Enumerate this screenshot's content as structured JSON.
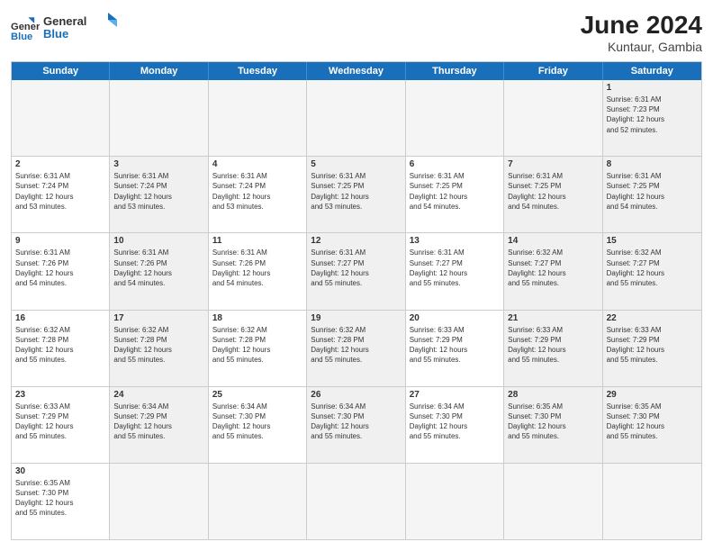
{
  "header": {
    "logo_general": "General",
    "logo_blue": "Blue",
    "month_year": "June 2024",
    "location": "Kuntaur, Gambia"
  },
  "days_of_week": [
    "Sunday",
    "Monday",
    "Tuesday",
    "Wednesday",
    "Thursday",
    "Friday",
    "Saturday"
  ],
  "weeks": [
    [
      {
        "day": "",
        "empty": true
      },
      {
        "day": "",
        "empty": true
      },
      {
        "day": "",
        "empty": true
      },
      {
        "day": "",
        "empty": true
      },
      {
        "day": "",
        "empty": true
      },
      {
        "day": "",
        "empty": true
      },
      {
        "day": "1",
        "info": "Sunrise: 6:31 AM\nSunset: 7:23 PM\nDaylight: 12 hours\nand 52 minutes.",
        "shaded": true
      }
    ],
    [
      {
        "day": "2",
        "info": "Sunrise: 6:31 AM\nSunset: 7:24 PM\nDaylight: 12 hours\nand 53 minutes.",
        "shaded": false
      },
      {
        "day": "3",
        "info": "Sunrise: 6:31 AM\nSunset: 7:24 PM\nDaylight: 12 hours\nand 53 minutes.",
        "shaded": true
      },
      {
        "day": "4",
        "info": "Sunrise: 6:31 AM\nSunset: 7:24 PM\nDaylight: 12 hours\nand 53 minutes.",
        "shaded": false
      },
      {
        "day": "5",
        "info": "Sunrise: 6:31 AM\nSunset: 7:25 PM\nDaylight: 12 hours\nand 53 minutes.",
        "shaded": true
      },
      {
        "day": "6",
        "info": "Sunrise: 6:31 AM\nSunset: 7:25 PM\nDaylight: 12 hours\nand 54 minutes.",
        "shaded": false
      },
      {
        "day": "7",
        "info": "Sunrise: 6:31 AM\nSunset: 7:25 PM\nDaylight: 12 hours\nand 54 minutes.",
        "shaded": true
      },
      {
        "day": "8",
        "info": "Sunrise: 6:31 AM\nSunset: 7:25 PM\nDaylight: 12 hours\nand 54 minutes.",
        "shaded": true
      }
    ],
    [
      {
        "day": "9",
        "info": "Sunrise: 6:31 AM\nSunset: 7:26 PM\nDaylight: 12 hours\nand 54 minutes.",
        "shaded": false
      },
      {
        "day": "10",
        "info": "Sunrise: 6:31 AM\nSunset: 7:26 PM\nDaylight: 12 hours\nand 54 minutes.",
        "shaded": true
      },
      {
        "day": "11",
        "info": "Sunrise: 6:31 AM\nSunset: 7:26 PM\nDaylight: 12 hours\nand 54 minutes.",
        "shaded": false
      },
      {
        "day": "12",
        "info": "Sunrise: 6:31 AM\nSunset: 7:27 PM\nDaylight: 12 hours\nand 55 minutes.",
        "shaded": true
      },
      {
        "day": "13",
        "info": "Sunrise: 6:31 AM\nSunset: 7:27 PM\nDaylight: 12 hours\nand 55 minutes.",
        "shaded": false
      },
      {
        "day": "14",
        "info": "Sunrise: 6:32 AM\nSunset: 7:27 PM\nDaylight: 12 hours\nand 55 minutes.",
        "shaded": true
      },
      {
        "day": "15",
        "info": "Sunrise: 6:32 AM\nSunset: 7:27 PM\nDaylight: 12 hours\nand 55 minutes.",
        "shaded": true
      }
    ],
    [
      {
        "day": "16",
        "info": "Sunrise: 6:32 AM\nSunset: 7:28 PM\nDaylight: 12 hours\nand 55 minutes.",
        "shaded": false
      },
      {
        "day": "17",
        "info": "Sunrise: 6:32 AM\nSunset: 7:28 PM\nDaylight: 12 hours\nand 55 minutes.",
        "shaded": true
      },
      {
        "day": "18",
        "info": "Sunrise: 6:32 AM\nSunset: 7:28 PM\nDaylight: 12 hours\nand 55 minutes.",
        "shaded": false
      },
      {
        "day": "19",
        "info": "Sunrise: 6:32 AM\nSunset: 7:28 PM\nDaylight: 12 hours\nand 55 minutes.",
        "shaded": true
      },
      {
        "day": "20",
        "info": "Sunrise: 6:33 AM\nSunset: 7:29 PM\nDaylight: 12 hours\nand 55 minutes.",
        "shaded": false
      },
      {
        "day": "21",
        "info": "Sunrise: 6:33 AM\nSunset: 7:29 PM\nDaylight: 12 hours\nand 55 minutes.",
        "shaded": true
      },
      {
        "day": "22",
        "info": "Sunrise: 6:33 AM\nSunset: 7:29 PM\nDaylight: 12 hours\nand 55 minutes.",
        "shaded": true
      }
    ],
    [
      {
        "day": "23",
        "info": "Sunrise: 6:33 AM\nSunset: 7:29 PM\nDaylight: 12 hours\nand 55 minutes.",
        "shaded": false
      },
      {
        "day": "24",
        "info": "Sunrise: 6:34 AM\nSunset: 7:29 PM\nDaylight: 12 hours\nand 55 minutes.",
        "shaded": true
      },
      {
        "day": "25",
        "info": "Sunrise: 6:34 AM\nSunset: 7:30 PM\nDaylight: 12 hours\nand 55 minutes.",
        "shaded": false
      },
      {
        "day": "26",
        "info": "Sunrise: 6:34 AM\nSunset: 7:30 PM\nDaylight: 12 hours\nand 55 minutes.",
        "shaded": true
      },
      {
        "day": "27",
        "info": "Sunrise: 6:34 AM\nSunset: 7:30 PM\nDaylight: 12 hours\nand 55 minutes.",
        "shaded": false
      },
      {
        "day": "28",
        "info": "Sunrise: 6:35 AM\nSunset: 7:30 PM\nDaylight: 12 hours\nand 55 minutes.",
        "shaded": true
      },
      {
        "day": "29",
        "info": "Sunrise: 6:35 AM\nSunset: 7:30 PM\nDaylight: 12 hours\nand 55 minutes.",
        "shaded": true
      }
    ],
    [
      {
        "day": "30",
        "info": "Sunrise: 6:35 AM\nSunset: 7:30 PM\nDaylight: 12 hours\nand 55 minutes.",
        "shaded": false
      },
      {
        "day": "",
        "empty": true
      },
      {
        "day": "",
        "empty": true
      },
      {
        "day": "",
        "empty": true
      },
      {
        "day": "",
        "empty": true
      },
      {
        "day": "",
        "empty": true
      },
      {
        "day": "",
        "empty": true
      }
    ]
  ]
}
